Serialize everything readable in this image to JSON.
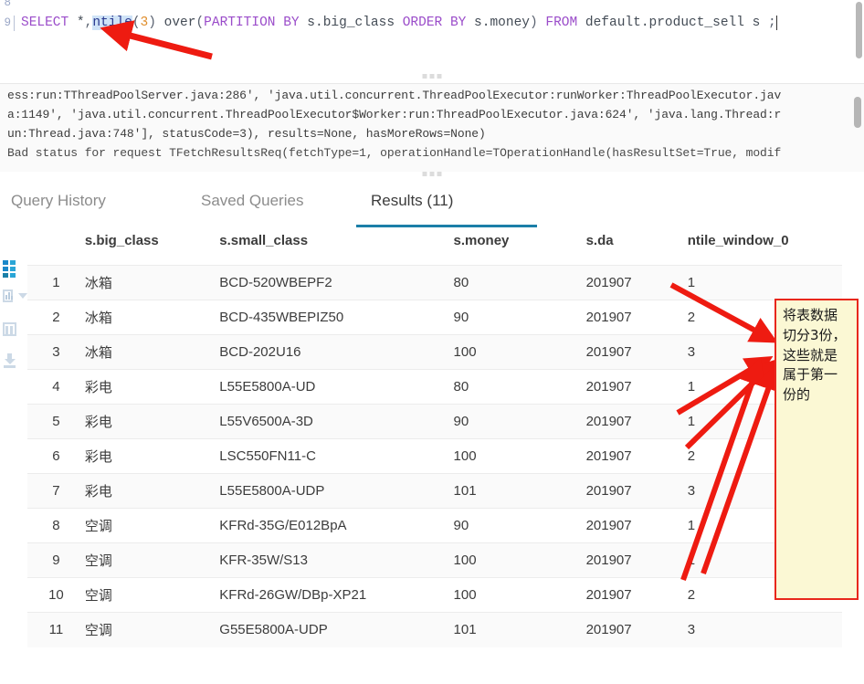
{
  "editor": {
    "prev_line_number": "8",
    "line_number": "9",
    "sql_tokens": [
      {
        "t": "SELECT",
        "k": "kw"
      },
      {
        "t": " *",
        "k": "id"
      },
      {
        "t": ",",
        "k": "punct"
      },
      {
        "t": "ntile",
        "k": "fn"
      },
      {
        "t": "(",
        "k": "punct"
      },
      {
        "t": "3",
        "k": "num"
      },
      {
        "t": ")",
        "k": "punct"
      },
      {
        "t": " over",
        "k": "id"
      },
      {
        "t": "(",
        "k": "punct"
      },
      {
        "t": "PARTITION",
        "k": "kw"
      },
      {
        "t": " ",
        "k": "id"
      },
      {
        "t": "BY",
        "k": "kw"
      },
      {
        "t": " s.big_class ",
        "k": "id"
      },
      {
        "t": "ORDER",
        "k": "kw"
      },
      {
        "t": " ",
        "k": "id"
      },
      {
        "t": "BY",
        "k": "kw"
      },
      {
        "t": " s.money",
        "k": "id"
      },
      {
        "t": ")",
        "k": "punct"
      },
      {
        "t": " ",
        "k": "id"
      },
      {
        "t": "FROM",
        "k": "kw"
      },
      {
        "t": " default.product_sell s ",
        "k": "id"
      },
      {
        "t": ";",
        "k": "punct"
      }
    ],
    "sql_plain": "SELECT *,ntile(3) over(PARTITION BY s.big_class ORDER BY s.money) FROM default.product_sell s ;",
    "highlighted_token": "ntile"
  },
  "log": {
    "lines": [
      "ess:run:TThreadPoolServer.java:286', 'java.util.concurrent.ThreadPoolExecutor:runWorker:ThreadPoolExecutor.jav",
      "a:1149', 'java.util.concurrent.ThreadPoolExecutor$Worker:run:ThreadPoolExecutor.java:624', 'java.lang.Thread:r",
      "un:Thread.java:748'], statusCode=3), results=None, hasMoreRows=None)",
      "Bad status for request TFetchResultsReq(fetchType=1, operationHandle=TOperationHandle(hasResultSet=True, modif"
    ]
  },
  "tabs": [
    {
      "label": "Query History",
      "active": false
    },
    {
      "label": "Saved Queries",
      "active": false
    },
    {
      "label": "Results (11)",
      "active": true
    }
  ],
  "rail": {
    "items": [
      {
        "name": "grid-view-icon",
        "label": "Grid"
      },
      {
        "name": "chart-view-icon",
        "label": "Chart"
      },
      {
        "name": "columns-icon",
        "label": "Columns"
      },
      {
        "name": "download-icon",
        "label": "Download"
      }
    ]
  },
  "table": {
    "columns": [
      "",
      "s.big_class",
      "s.small_class",
      "s.money",
      "s.da",
      "ntile_window_0"
    ],
    "rows": [
      [
        "1",
        "冰箱",
        "BCD-520WBEPF2",
        "80",
        "201907",
        "1"
      ],
      [
        "2",
        "冰箱",
        "BCD-435WBEPIZ50",
        "90",
        "201907",
        "2"
      ],
      [
        "3",
        "冰箱",
        "BCD-202U16",
        "100",
        "201907",
        "3"
      ],
      [
        "4",
        "彩电",
        "L55E5800A-UD",
        "80",
        "201907",
        "1"
      ],
      [
        "5",
        "彩电",
        "L55V6500A-3D",
        "90",
        "201907",
        "1"
      ],
      [
        "6",
        "彩电",
        "LSC550FN11-C",
        "100",
        "201907",
        "2"
      ],
      [
        "7",
        "彩电",
        "L55E5800A-UDP",
        "101",
        "201907",
        "3"
      ],
      [
        "8",
        "空调",
        "KFRd-35G/E012BpA",
        "90",
        "201907",
        "1"
      ],
      [
        "9",
        "空调",
        "KFR-35W/S13",
        "100",
        "201907",
        "1"
      ],
      [
        "10",
        "空调",
        "KFRd-26GW/DBp-XP21",
        "100",
        "201907",
        "2"
      ],
      [
        "11",
        "空调",
        "G55E5800A-UDP",
        "101",
        "201907",
        "3"
      ]
    ]
  },
  "annotation": {
    "text": "将表数据切分3份，这些就是属于第一份的",
    "border_color": "#e8271c",
    "background_color": "#fbf8d4",
    "arrow_color": "#ee1b11"
  },
  "colors": {
    "tab_active_underline": "#1b7fa8",
    "grid_icon": "#1b88c9",
    "keyword": "#9b4dca",
    "number": "#e08f2e",
    "function_highlight": "#cfe3f7"
  }
}
